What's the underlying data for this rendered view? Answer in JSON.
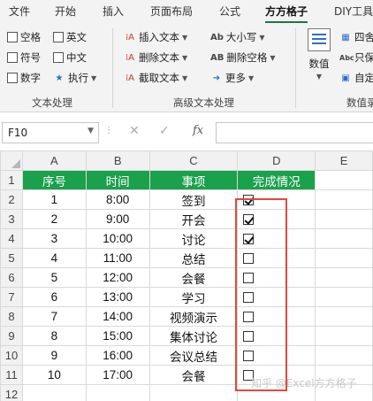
{
  "ribbon_tabs": [
    "文件",
    "开始",
    "插入",
    "页面布局",
    "公式",
    "方方格子",
    "DIY工具"
  ],
  "active_tab": "方方格子",
  "text_group": {
    "checkboxes": [
      "空格",
      "英文",
      "符号",
      "中文",
      "数字"
    ],
    "execute": "执行",
    "label": "文本处理"
  },
  "advanced_group": {
    "insert_text": "插入文本",
    "delete_text": "删除文本",
    "extract_text": "截取文本",
    "case": "大小写",
    "delete_spaces": "删除空格",
    "more": "更多",
    "label": "高级文本处理"
  },
  "numeric_group": {
    "value_button": "数值",
    "round": "四舍",
    "only": "只保",
    "custom": "自定",
    "label": "数值录"
  },
  "formula_bar": {
    "name_box": "F10",
    "fx": "fx",
    "cancel": "✕",
    "enter": "✓"
  },
  "columns": [
    "A",
    "B",
    "C",
    "D",
    "E"
  ],
  "row_numbers": [
    "1",
    "2",
    "3",
    "4",
    "5",
    "6",
    "7",
    "8",
    "9",
    "10",
    "11",
    "12"
  ],
  "headers": [
    "序号",
    "时间",
    "事项",
    "完成情况"
  ],
  "rows": [
    {
      "no": "1",
      "time": "8:00",
      "item": "签到",
      "done": true
    },
    {
      "no": "2",
      "time": "9:00",
      "item": "开会",
      "done": true
    },
    {
      "no": "3",
      "time": "10:00",
      "item": "讨论",
      "done": true
    },
    {
      "no": "4",
      "time": "11:00",
      "item": "总结",
      "done": false
    },
    {
      "no": "5",
      "time": "12:00",
      "item": "会餐",
      "done": false
    },
    {
      "no": "6",
      "time": "13:00",
      "item": "学习",
      "done": false
    },
    {
      "no": "7",
      "time": "14:00",
      "item": "视频演示",
      "done": false
    },
    {
      "no": "8",
      "time": "15:00",
      "item": "集体讨论",
      "done": false
    },
    {
      "no": "9",
      "time": "16:00",
      "item": "会议总结",
      "done": false
    },
    {
      "no": "10",
      "time": "17:00",
      "item": "会餐",
      "done": false
    }
  ],
  "watermark": "知乎 @Excel方方格子",
  "colors": {
    "header_fill": "#1aa14b",
    "highlight_box": "#e04a3c",
    "accent": "#217346"
  }
}
